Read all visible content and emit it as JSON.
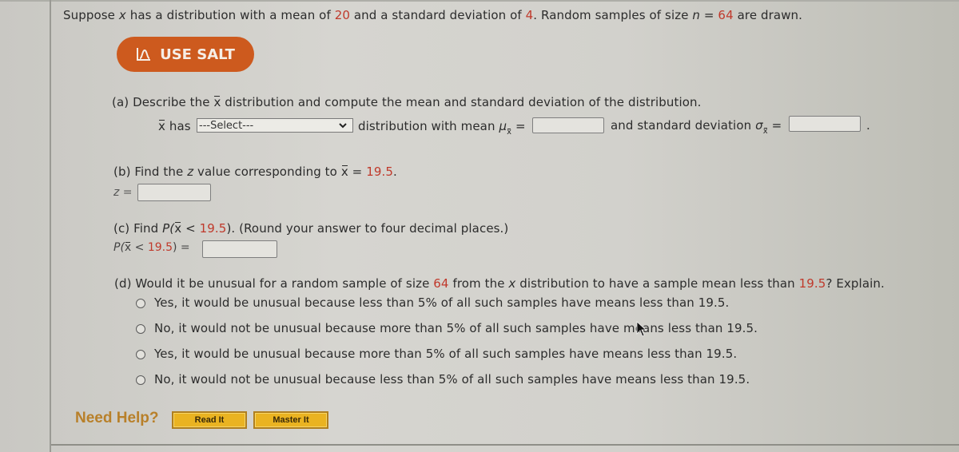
{
  "problem": {
    "intro_parts": [
      "Suppose ",
      "x",
      " has a distribution with a mean of ",
      "20",
      " and a standard deviation of ",
      "4",
      ". Random samples of size ",
      "n",
      " = ",
      "64",
      " are drawn."
    ]
  },
  "salt_button": {
    "label": "USE SALT",
    "icon": "salt-graph-icon"
  },
  "part_a": {
    "prompt_pre": "(a) Describe the ",
    "prompt_var": "x",
    "prompt_post": " distribution and compute the mean and standard deviation of the distribution.",
    "row_var": "x",
    "row_has": " has",
    "select_value": "---Select---",
    "mean_label": "distribution with mean ",
    "mean_symbol": "μ",
    "mean_sub": "x",
    "equals": "=",
    "mean_value": "",
    "sd_label": "and standard deviation ",
    "sd_symbol": "σ",
    "sd_sub": "x",
    "sd_value": "",
    "period": "."
  },
  "part_b": {
    "prompt_pre": "(b) Find the ",
    "prompt_z": "z",
    "prompt_mid": " value corresponding to ",
    "prompt_var": "x",
    "prompt_eq": " = ",
    "prompt_value": "19.5",
    "prompt_end": ".",
    "answer_label": "z",
    "answer_eq": " =",
    "answer_value": ""
  },
  "part_c": {
    "prompt_pre": "(c) Find ",
    "prompt_P": "P(",
    "prompt_var": "x",
    "prompt_lt": " < ",
    "prompt_value": "19.5",
    "prompt_close": ").",
    "prompt_post": " (Round your answer to four decimal places.)",
    "answer_P": "P(",
    "answer_var": "x",
    "answer_lt": " < ",
    "answer_value_ref": "19.5",
    "answer_close": ") =",
    "answer_value": ""
  },
  "part_d": {
    "prompt_pre": "(d) Would it be unusual for a random sample of size ",
    "prompt_n": "64",
    "prompt_mid": " from the ",
    "prompt_var": "x",
    "prompt_mid2": " distribution to have a sample mean less than ",
    "prompt_value": "19.5",
    "prompt_end": "? Explain.",
    "options": [
      {
        "label": "Yes, it would be unusual because less than 5% of all such samples have means less than 19.5.",
        "selected": false
      },
      {
        "label": "No, it would not be unusual because more than 5% of all such samples have means less than 19.5.",
        "selected": false
      },
      {
        "label": "Yes, it would be unusual because more than 5% of all such samples have means less than 19.5.",
        "selected": false
      },
      {
        "label": "No, it would not be unusual because less than 5% of all such samples have means less than 19.5.",
        "selected": false
      }
    ]
  },
  "help": {
    "label": "Need Help?",
    "read_it": "Read It",
    "master_it": "Master It"
  },
  "colors": {
    "value_red": "#c0392b",
    "salt_orange": "#cd5a1e",
    "help_gold": "#eab321",
    "help_text": "#b8802a"
  }
}
